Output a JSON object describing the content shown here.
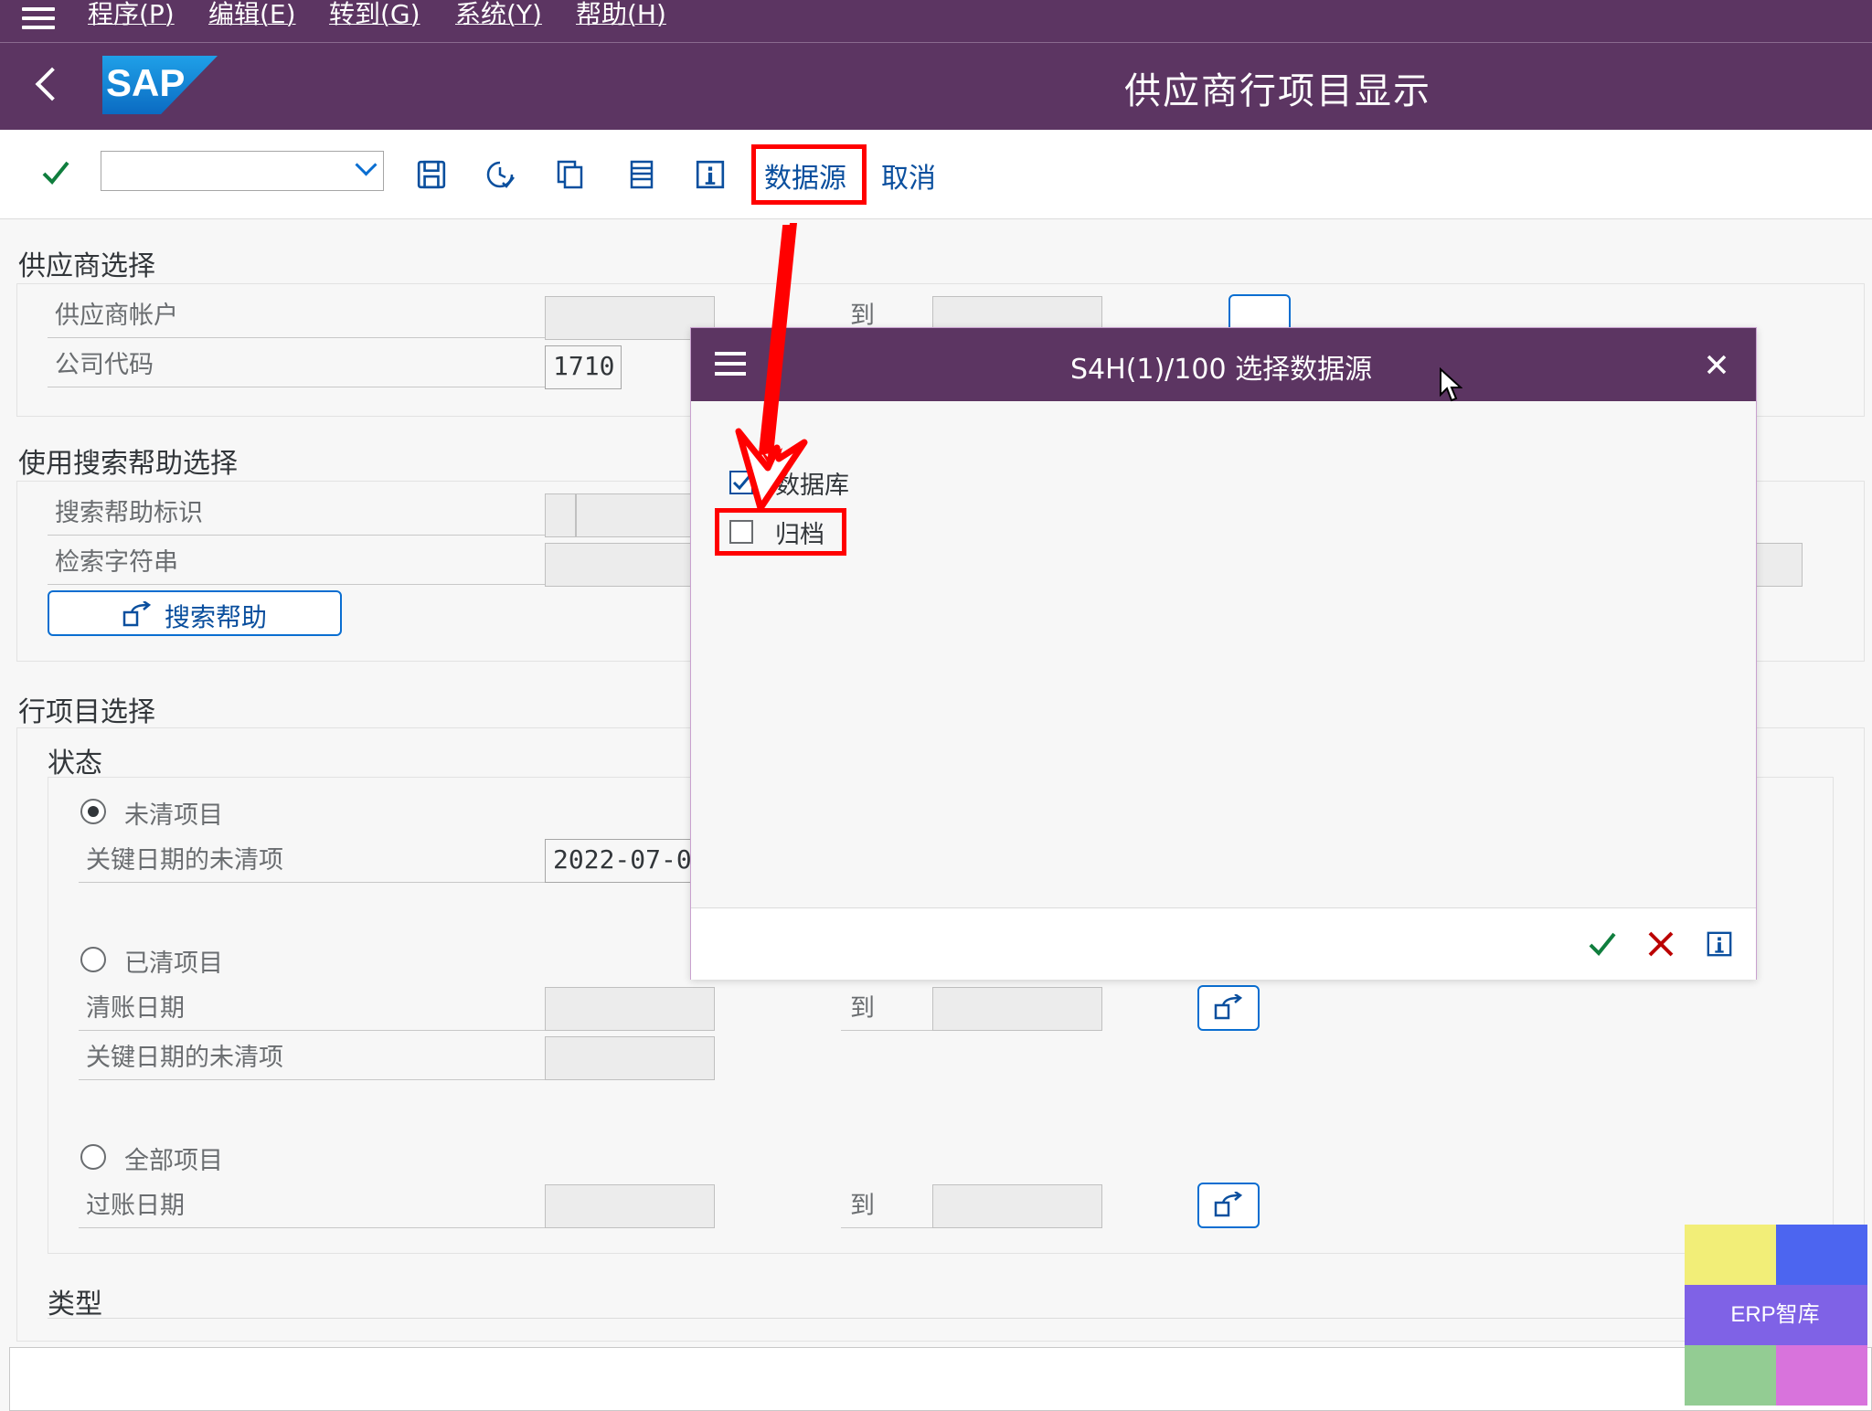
{
  "menu": {
    "items": [
      "程序(P)",
      "编辑(E)",
      "转到(G)",
      "系统(Y)",
      "帮助(H)"
    ]
  },
  "title": {
    "logo_text": "SAP",
    "page_title": "供应商行项目显示"
  },
  "toolbar": {
    "command_value": "",
    "data_source_label": "数据源",
    "cancel_label": "取消"
  },
  "vendor_selection": {
    "title": "供应商选择",
    "vendor_account_label": "供应商帐户",
    "to_label": "到",
    "company_code_label": "公司代码",
    "company_code_value": "1710"
  },
  "search_help_selection": {
    "title": "使用搜索帮助选择",
    "search_help_id_label": "搜索帮助标识",
    "search_string_label": "检索字符串",
    "search_help_button": "搜索帮助"
  },
  "line_item_selection": {
    "title": "行项目选择",
    "status_title": "状态",
    "open_items_label": "未清项目",
    "open_at_key_date_label": "关键日期的未清项",
    "open_key_date_value": "2022-07-0",
    "cleared_items_label": "已清项目",
    "clearing_date_label": "清账日期",
    "to_label": "到",
    "cleared_open_key_date_label": "关键日期的未清项",
    "all_items_label": "全部项目",
    "posting_date_label": "过账日期",
    "type_title": "类型"
  },
  "dialog": {
    "title": "S4H(1)/100 选择数据源",
    "database_label": "数据库",
    "database_checked": true,
    "archive_label": "归档",
    "archive_checked": false
  },
  "watermark": {
    "text": "ERP智库"
  },
  "colors": {
    "shell": "#5c3562",
    "link": "#0a4f9e",
    "accent_green": "#107e3e",
    "cancel_red": "#bb0000",
    "highlight": "#ff0000"
  }
}
